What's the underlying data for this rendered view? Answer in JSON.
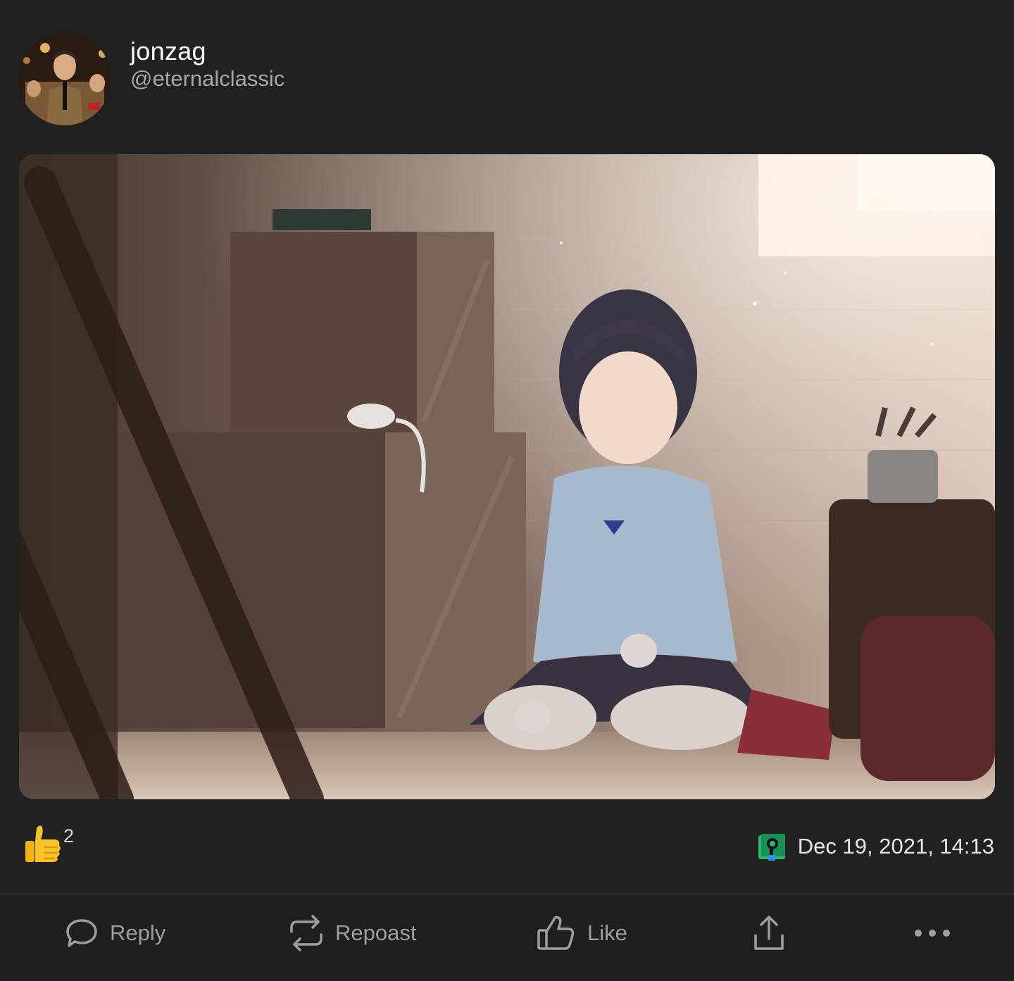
{
  "author": {
    "display_name": "jonzag",
    "handle": "@eternalclassic",
    "avatar_icon": "profile-photo"
  },
  "post": {
    "image_icon": "anime-illustration"
  },
  "reactions": {
    "icon": "thumbs-up-emoji",
    "count": "2"
  },
  "meta": {
    "app_icon": "client-app-logo",
    "timestamp": "Dec 19, 2021, 14:13"
  },
  "actions": {
    "reply_label": "Reply",
    "repost_label": "Repoast",
    "like_label": "Like",
    "share_icon": "share-icon",
    "more_icon": "more-icon"
  },
  "colors": {
    "background": "#212121",
    "action_bar": "#1f1f1f",
    "muted_text": "#9e9e9e",
    "reaction_yellow": "#f7c326",
    "app_green": "#2bb673"
  }
}
